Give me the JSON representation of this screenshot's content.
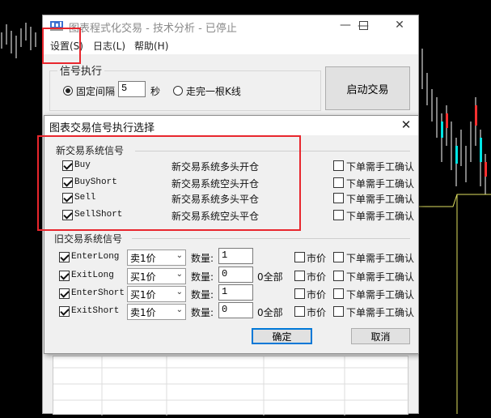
{
  "main_window": {
    "title": "图表程式化交易 - 技术分析 - 已停止",
    "menu": [
      "设置(S)",
      "日志(L)",
      "帮助(H)"
    ],
    "signal_exec": {
      "group_label": "信号执行",
      "fixed_interval_label": "固定间隔",
      "interval_value": "5",
      "seconds_label": "秒",
      "after_bar_label": "走完一根K线"
    },
    "start_trade_label": "启动交易"
  },
  "dialog": {
    "title": "图表交易信号执行选择",
    "new_group_label": "新交易系统信号",
    "new_signals": [
      {
        "name": "Buy",
        "desc": "新交易系统多头开仓",
        "manual_label": "下单需手工确认"
      },
      {
        "name": "BuyShort",
        "desc": "新交易系统空头开仓",
        "manual_label": "下单需手工确认"
      },
      {
        "name": "Sell",
        "desc": "新交易系统多头平仓",
        "manual_label": "下单需手工确认"
      },
      {
        "name": "SellShort",
        "desc": "新交易系统空头平仓",
        "manual_label": "下单需手工确认"
      }
    ],
    "old_group_label": "旧交易系统信号",
    "old_signals": [
      {
        "name": "EnterLong",
        "price": "卖1价",
        "qty_label": "数量:",
        "qty": "1",
        "all_label": "",
        "market_label": "市价",
        "manual_label": "下单需手工确认"
      },
      {
        "name": "ExitLong",
        "price": "买1价",
        "qty_label": "数量:",
        "qty": "0",
        "all_label": "0全部",
        "market_label": "市价",
        "manual_label": "下单需手工确认"
      },
      {
        "name": "EnterShort",
        "price": "买1价",
        "qty_label": "数量:",
        "qty": "1",
        "all_label": "",
        "market_label": "市价",
        "manual_label": "下单需手工确认"
      },
      {
        "name": "ExitShort",
        "price": "卖1价",
        "qty_label": "数量:",
        "qty": "0",
        "all_label": "0全部",
        "market_label": "市价",
        "manual_label": "下单需手工确认"
      }
    ],
    "ok_label": "确定",
    "cancel_label": "取消"
  },
  "colors": {
    "highlight": "#e8262d",
    "default_button": "#0078d7"
  }
}
